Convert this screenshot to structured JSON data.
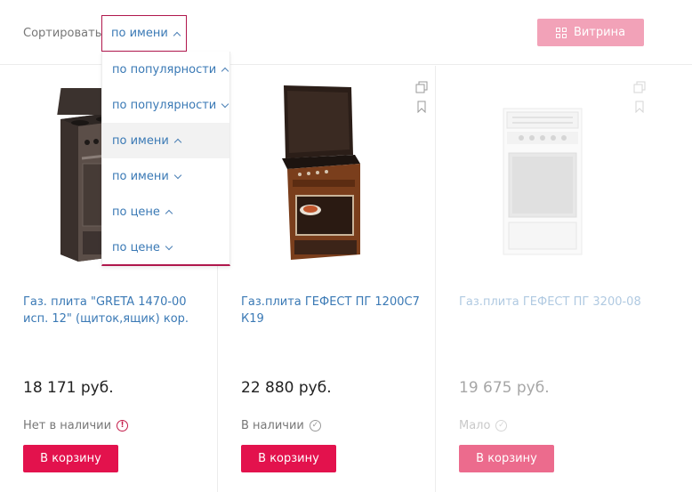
{
  "sort": {
    "label": "Сортировать:",
    "current": "по имени"
  },
  "view_button": {
    "label": "Витрина",
    "icon": "grid-icon"
  },
  "dropdown": {
    "items": [
      {
        "label": "по популярности",
        "direction": "asc"
      },
      {
        "label": "по популярности",
        "direction": "desc"
      },
      {
        "label": "по имени",
        "direction": "asc",
        "selected": true
      },
      {
        "label": "по имени",
        "direction": "desc"
      },
      {
        "label": "по цене",
        "direction": "asc"
      },
      {
        "label": "по цене",
        "direction": "desc"
      }
    ]
  },
  "products": [
    {
      "title": "Газ. плита \"GRETA 1470-00 исп. 12\" (щиток,ящик) кор.",
      "price": "18 171 руб.",
      "stock": "Нет в наличии",
      "stock_icon": "warning-icon",
      "button": "В корзину"
    },
    {
      "title": "Газ.плита ГЕФЕСТ ПГ 1200С7 К19",
      "price": "22 880 руб.",
      "stock": "В наличии",
      "stock_icon": "check-icon",
      "button": "В корзину"
    },
    {
      "title": "Газ.плита ГЕФЕСТ ПГ 3200-08",
      "price": "19 675 руб.",
      "stock": "Мало",
      "stock_icon": "check-icon",
      "button": "В корзину"
    }
  ],
  "colors": {
    "accent": "#e3124d",
    "accent_dark": "#b0174c",
    "link": "#3a79b5",
    "view_button": "#f2a2b8"
  }
}
